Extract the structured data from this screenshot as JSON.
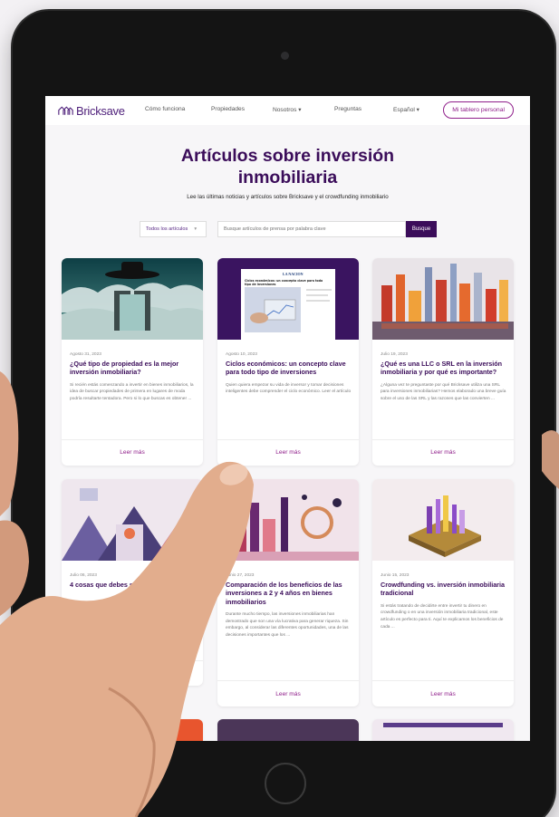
{
  "nav": {
    "brand": "Bricksave",
    "links": [
      "Cómo funciona",
      "Propiedades",
      "Nosotros ▾",
      "Preguntas",
      "Español ▾"
    ],
    "cta": "Mi tablero personal"
  },
  "hero": {
    "title_line1": "Artículos sobre inversión",
    "title_line2": "inmobiliaria",
    "subtitle": "Lee las últimas noticias y artículos sobre Bricksave y el crowdfunding inmobiliario"
  },
  "search": {
    "filter_value": "Todos los artículos",
    "placeholder": "Busque artículos de prensa por palabra clave",
    "button": "Busque"
  },
  "articles": [
    {
      "date": "Agosto 31, 2023",
      "title": "¿Qué tipo de propiedad es la mejor inversión inmobiliaria?",
      "excerpt": "Si recién estás comenzando a invertir en bienes inmobiliarios, la idea de buscar propiedades de primera en lugares de moda podría resultarte tentadora. Pero si lo que buscas es obtener ...",
      "more": "Leer más"
    },
    {
      "date": "Agosto 10, 2023",
      "title": "Ciclos económicos: un concepto clave para todo tipo de inversiones",
      "excerpt": "Quien quiera empezar su vida de inversor y tomar decisiones inteligentes debe comprender el ciclo económico. Leer el artículo",
      "more": "Leer más"
    },
    {
      "date": "Julio 19, 2023",
      "title": "¿Qué es una LLC o SRL en la inversión inmobiliaria y por qué es importante?",
      "excerpt": "¿Alguna vez te preguntaste por qué Bricksave utiliza una SRL para inversiones inmobiliarias? Hemos elaborado una breve guía sobre el uso de las SRL y las razones que las convierten ...",
      "more": "Leer más"
    },
    {
      "date": "Julio 06, 2023",
      "title": "4 cosas que debes s gestión de propied",
      "excerpt": "",
      "more": "Leer más"
    },
    {
      "date": "Junio 27, 2023",
      "title": "Comparación de los beneficios de las inversiones a 2 y 4 años en bienes inmobiliarios",
      "excerpt": "Durante mucho tiempo, las inversiones inmobiliarias han demostrado que son una vía lucrativa para generar riqueza. Sin embargo, al considerar las diferentes oportunidades, una de las decisiones importantes que los ...",
      "more": "Leer más"
    },
    {
      "date": "Junio 15, 2023",
      "title": "Crowdfunding vs. inversión inmobiliaria tradicional",
      "excerpt": "Si estás tratando de decidirte entre invertir tu dinero en crowdfunding o en una inversión inmobiliaria tradicional, este artículo es perfecto para ti. Aquí te explicamos los beneficios de cada ...",
      "more": "Leer más"
    }
  ],
  "thumbnail_text": {
    "article2_header": "LA NACION",
    "article2_headline": "Ciclos económicos: un concepto clave para todo tipo de inversiones"
  },
  "colors": {
    "brand_purple": "#3b0d5a",
    "accent_magenta": "#8f1e8a",
    "device_frame": "#141414"
  }
}
